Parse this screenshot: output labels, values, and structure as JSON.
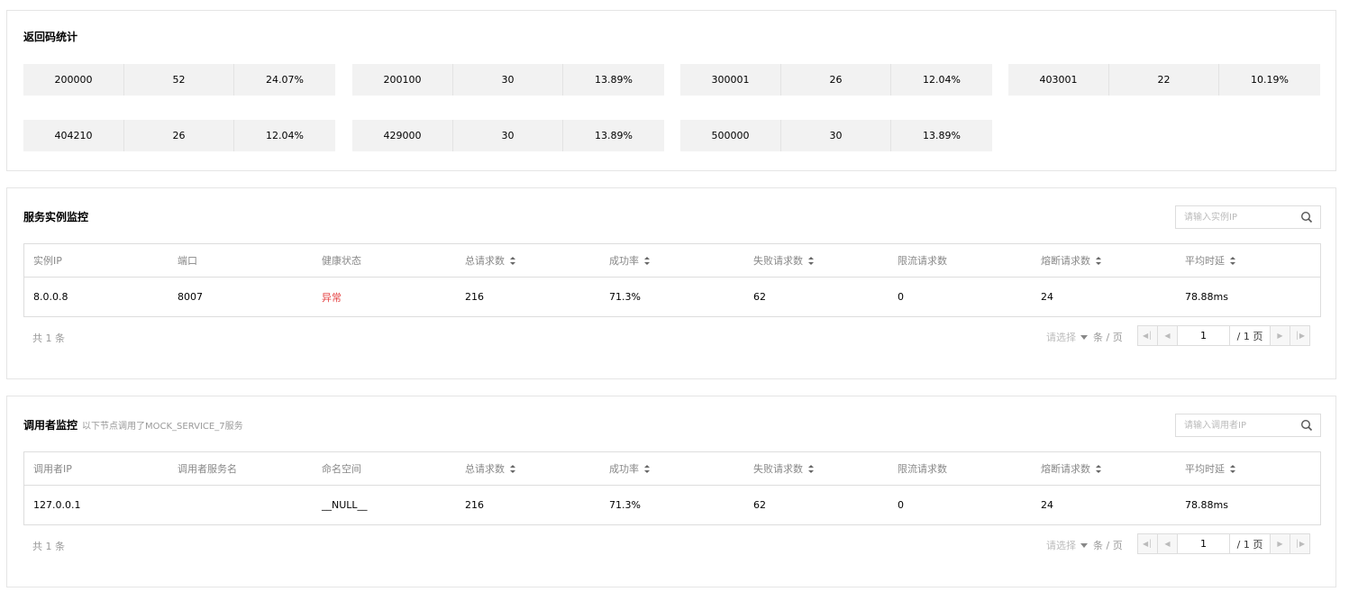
{
  "return_codes": {
    "title": "返回码统计",
    "items": [
      {
        "code": "200000",
        "count": "52",
        "pct": "24.07%"
      },
      {
        "code": "200100",
        "count": "30",
        "pct": "13.89%"
      },
      {
        "code": "300001",
        "count": "26",
        "pct": "12.04%"
      },
      {
        "code": "403001",
        "count": "22",
        "pct": "10.19%"
      },
      {
        "code": "404210",
        "count": "26",
        "pct": "12.04%"
      },
      {
        "code": "429000",
        "count": "30",
        "pct": "13.89%"
      },
      {
        "code": "500000",
        "count": "30",
        "pct": "13.89%"
      }
    ]
  },
  "instances": {
    "title": "服务实例监控",
    "search_placeholder": "请输入实例IP",
    "columns": [
      "实例IP",
      "端口",
      "健康状态",
      "总请求数",
      "成功率",
      "失败请求数",
      "限流请求数",
      "熔断请求数",
      "平均时延"
    ],
    "rows": [
      [
        "8.0.0.8",
        "8007",
        "异常",
        "216",
        "71.3%",
        "62",
        "0",
        "24",
        "78.88ms"
      ]
    ],
    "total": "共 1 条",
    "page_size_placeholder": "请选择",
    "page_size_unit": "条 / 页",
    "page": "1",
    "page_total": "/ 1 页"
  },
  "callers": {
    "title": "调用者监控",
    "subtitle": "以下节点调用了MOCK_SERVICE_7服务",
    "search_placeholder": "请输入调用者IP",
    "columns": [
      "调用者IP",
      "调用者服务名",
      "命名空间",
      "总请求数",
      "成功率",
      "失败请求数",
      "限流请求数",
      "熔断请求数",
      "平均时延"
    ],
    "rows": [
      [
        "127.0.0.1",
        "",
        "__NULL__",
        "216",
        "71.3%",
        "62",
        "0",
        "24",
        "78.88ms"
      ]
    ],
    "total": "共 1 条",
    "page_size_placeholder": "请选择",
    "page_size_unit": "条 / 页",
    "page": "1",
    "page_total": "/ 1 页"
  },
  "colors": {
    "danger": "#e54545",
    "card_bg": "#f2f2f2"
  }
}
